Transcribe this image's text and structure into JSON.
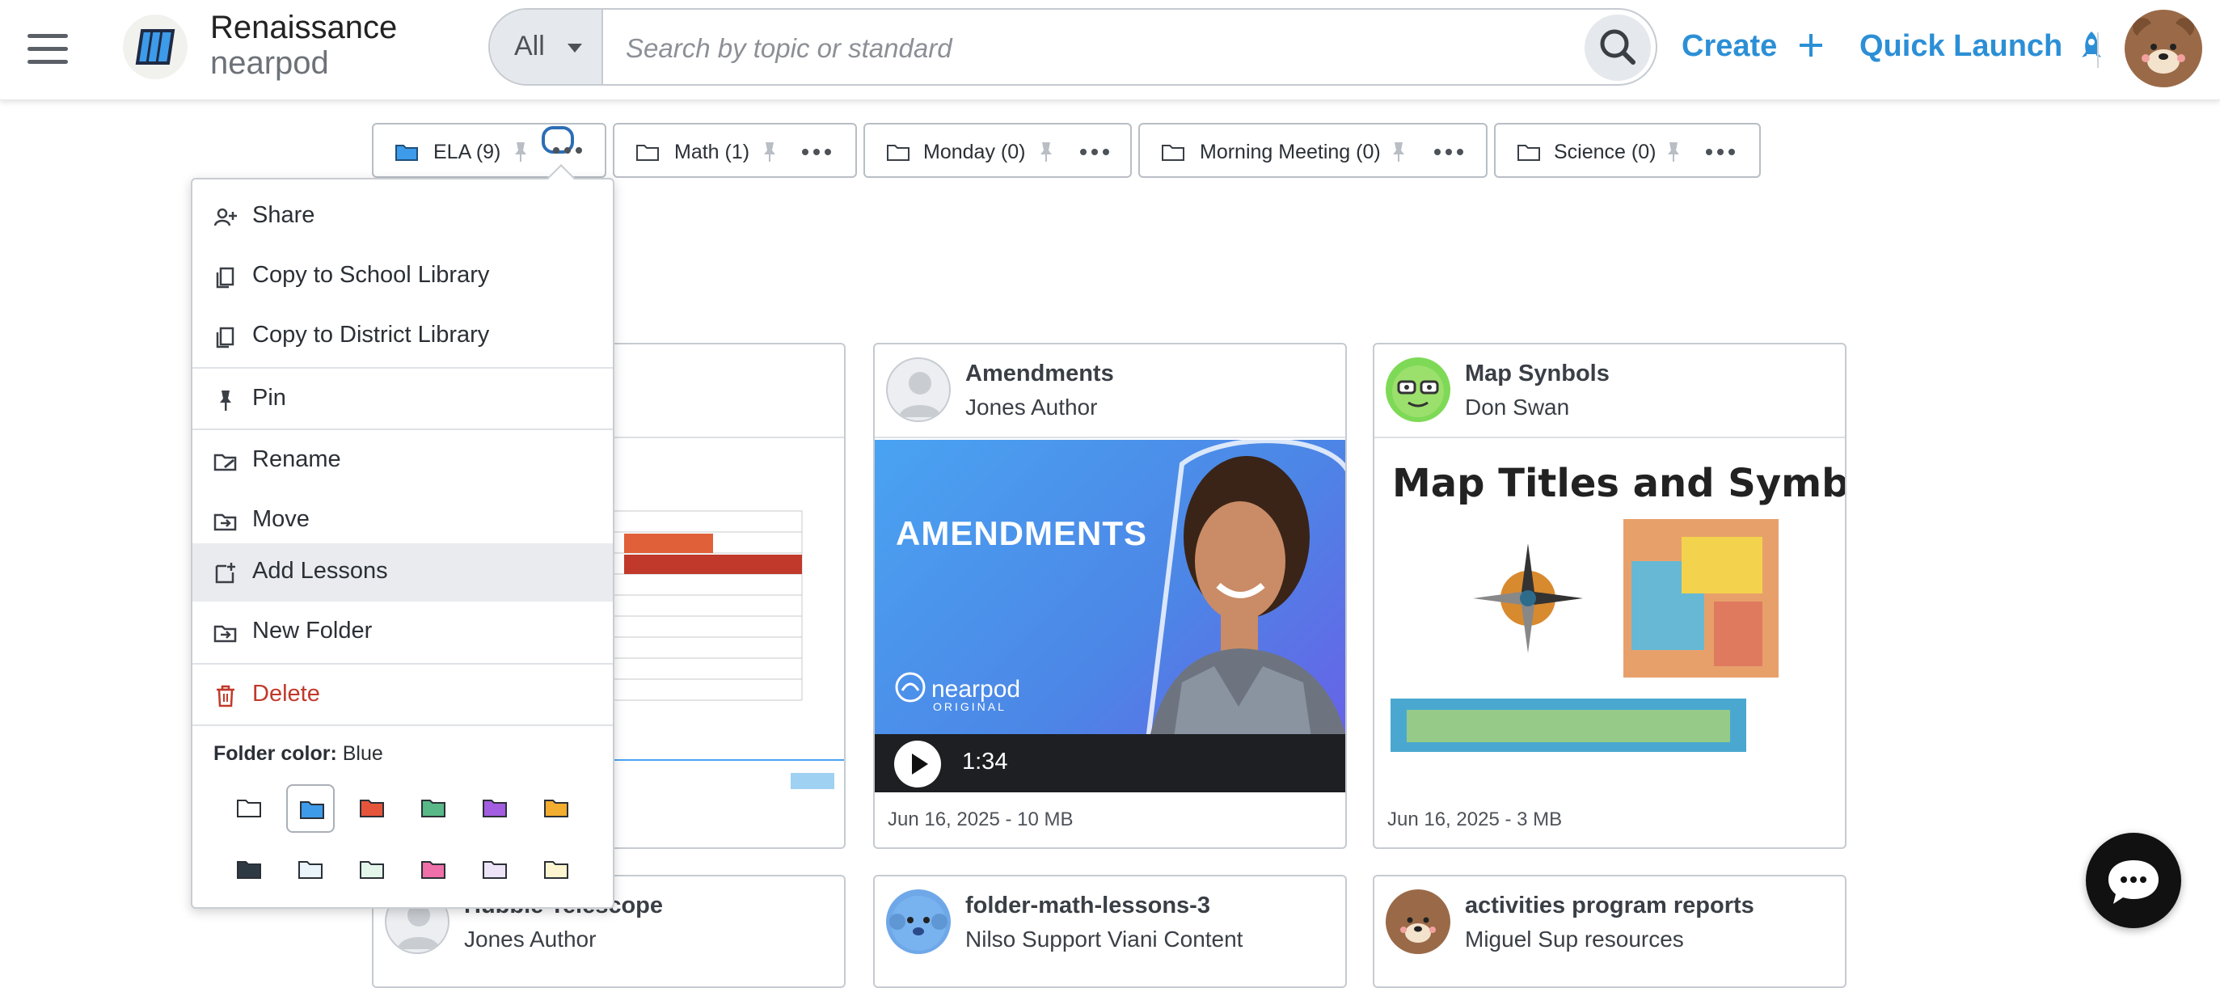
{
  "header": {
    "brand_top": "Renaissance",
    "brand_bottom": "nearpod",
    "search_scope": "All",
    "search_placeholder": "Search by topic or standard",
    "create_label": "Create",
    "quick_launch_label": "Quick Launch",
    "accent_color": "#2c8fd6"
  },
  "folders": [
    {
      "label": "ELA (9)",
      "color": "#3d9be9",
      "active": true
    },
    {
      "label": "Math (1)",
      "color": "none"
    },
    {
      "label": "Monday (0)",
      "color": "none"
    },
    {
      "label": "Morning Meeting (0)",
      "color": "none"
    },
    {
      "label": "Science (0)",
      "color": "none"
    }
  ],
  "menu": {
    "items": [
      {
        "label": "Share",
        "icon": "share-user-icon"
      },
      {
        "label": "Copy to School Library",
        "icon": "copy-icon"
      },
      {
        "label": "Copy to District Library",
        "icon": "copy-icon"
      },
      {
        "label": "Pin",
        "icon": "pin-icon"
      },
      {
        "label": "Rename",
        "icon": "rename-folder-icon"
      },
      {
        "label": "Move",
        "icon": "move-folder-icon"
      },
      {
        "label": "Add Lessons",
        "icon": "add-lessons-icon"
      },
      {
        "label": "New Folder",
        "icon": "new-folder-icon"
      },
      {
        "label": "Delete",
        "icon": "trash-icon"
      }
    ],
    "folder_color_label": "Folder color:",
    "folder_color_value": "Blue",
    "swatches_row1": [
      "#ffffff",
      "#3d9be9",
      "#e5553b",
      "#58b887",
      "#a35de0",
      "#f3ad2f"
    ],
    "swatches_row2": [
      "#2d3a44",
      "#eaf4fb",
      "#e4f6ea",
      "#ef6fa8",
      "#ede4f8",
      "#fdf5d0"
    ]
  },
  "cards": [
    {
      "title": "Amendments",
      "author": "Jones Author",
      "thumb_text": "AMENDMENTS",
      "duration": "1:34",
      "brand": "nearpod",
      "brand_sub": "ORIGINAL",
      "footer": "Jun 16, 2025 - 10 MB"
    },
    {
      "title": "Map Synbols",
      "author": "Don Swan",
      "thumb_text": "Map Titles and Symbols",
      "footer": "Jun 16, 2025 - 3 MB"
    },
    {
      "title": "Hubble Telescope",
      "author": "Jones Author"
    },
    {
      "title": "folder-math-lessons-3",
      "author": "Nilso Support Viani Content"
    },
    {
      "title": "activities program reports",
      "author": "Miguel Sup resources"
    }
  ]
}
